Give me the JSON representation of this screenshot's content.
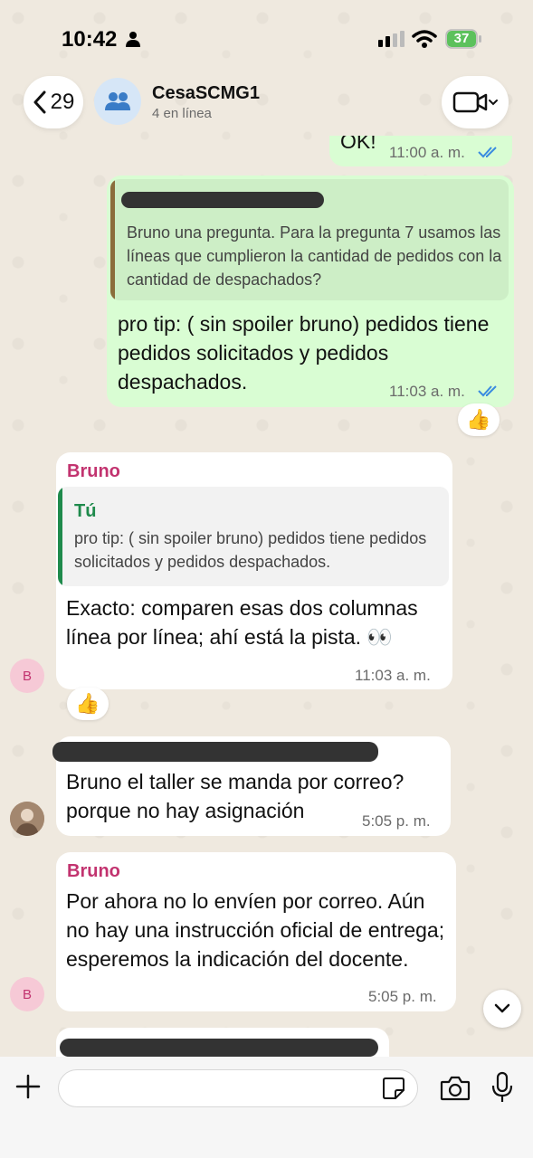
{
  "status_bar": {
    "time": "10:42",
    "battery": "37"
  },
  "header": {
    "back_count": "29",
    "group_name": "CesaSCMG1",
    "group_status": "4 en línea"
  },
  "messages": [
    {
      "type": "outgoing",
      "text": "OK!",
      "time": "11:00 a. m."
    },
    {
      "type": "outgoing",
      "quote_text": "Bruno una pregunta. Para la pregunta 7 usamos las líneas que cumplieron la cantidad de pedidos con la cantidad de despachados?",
      "text": "pro tip: ( sin spoiler bruno) pedidos tiene pedidos solicitados y pedidos despachados.",
      "time": "11:03 a. m.",
      "reaction": "👍"
    },
    {
      "type": "incoming",
      "sender": "Bruno",
      "avatar": "B",
      "quote_author": "Tú",
      "quote_text": "pro tip: ( sin spoiler bruno) pedidos tiene pedidos solicitados y pedidos despachados.",
      "text": "Exacto: comparen esas dos columnas línea por línea; ahí está la pista. 👀",
      "time": "11:03 a. m.",
      "reaction": "👍"
    },
    {
      "type": "incoming",
      "text": "Bruno el taller se manda por correo? porque no hay asignación",
      "time": "5:05 p. m."
    },
    {
      "type": "incoming",
      "sender": "Bruno",
      "avatar": "B",
      "text": "Por ahora no lo envíen por correo. Aún no hay una instrucción oficial de entrega; esperemos la indicación del docente.",
      "time": "5:05 p. m."
    }
  ],
  "composer": {
    "placeholder": ""
  },
  "colors": {
    "outgoing_bubble": "#d9fdd3",
    "incoming_bubble": "#ffffff",
    "sender_name": "#c2336f",
    "quote_self": "#1f8a4c",
    "tick_blue": "#3a8be0"
  }
}
